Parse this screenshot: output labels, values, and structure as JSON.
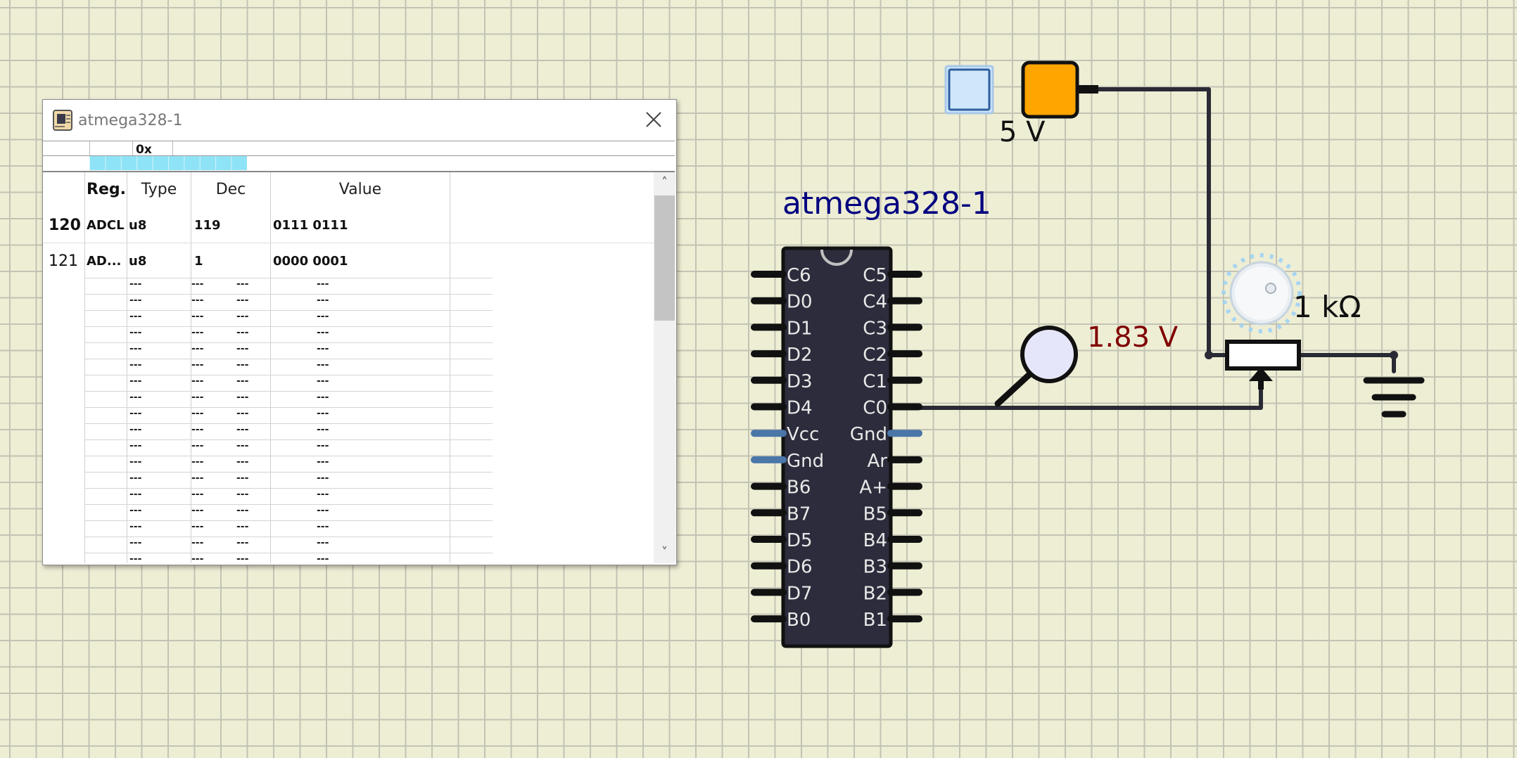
{
  "circuit": {
    "chip_label": "atmega328-1",
    "pins_left": [
      "C6",
      "D0",
      "D1",
      "D2",
      "D3",
      "D4",
      "Vcc",
      "Gnd",
      "B6",
      "B7",
      "D5",
      "D6",
      "D7",
      "B0"
    ],
    "pins_right": [
      "C5",
      "C4",
      "C3",
      "C2",
      "C1",
      "C0",
      "Gnd",
      "Ar",
      "A+",
      "B5",
      "B4",
      "B3",
      "B2",
      "B1"
    ],
    "supply_label": "5 V",
    "probe_label": "1.83 V",
    "resistor_label": "1 kΩ"
  },
  "colors": {
    "chip_body": "#2c2c3c",
    "power_pin": "#4a76a8",
    "supply_fill": "#ffa500",
    "probe_text": "#800000",
    "chip_label": "#000080",
    "memory_bar": "#8fe3f6"
  },
  "icons": {
    "chip": "chip-icon",
    "close": "close-icon",
    "scroll_up": "chevron-up-icon",
    "scroll_down": "chevron-down-icon"
  },
  "window": {
    "title": "atmega328-1",
    "hex_label": "0x",
    "headers": {
      "reg": "Reg.",
      "type": "Type",
      "dec": "Dec",
      "value": "Value"
    },
    "rows": [
      {
        "num": "120",
        "reg": "ADCL",
        "type": "u8",
        "dec": "119",
        "value": "0111 0111"
      },
      {
        "num": "121",
        "reg": "AD...",
        "type": "u8",
        "dec": "1",
        "value": "0000 0001"
      }
    ],
    "empty_cell": "---",
    "scroll_up": "˄",
    "scroll_down": "˅"
  }
}
